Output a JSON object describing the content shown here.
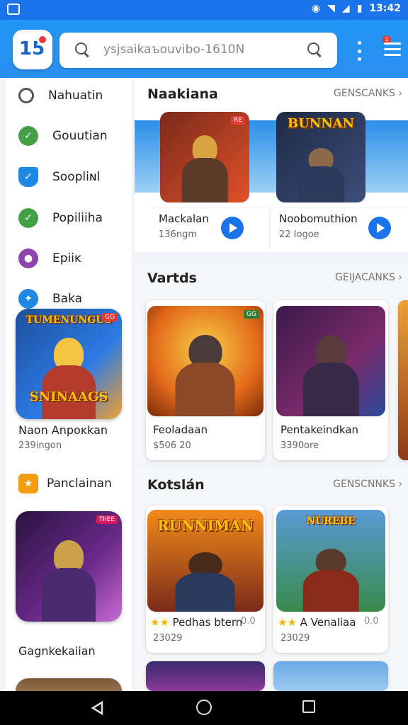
{
  "status": {
    "time": "13:42"
  },
  "header": {
    "logo_text": "15",
    "search_text": "ysjsaikaъouvibo-1610N",
    "menu_badge": "1"
  },
  "sidebar": {
    "items": [
      {
        "label": "Nahuatin",
        "icon": "search-person-icon",
        "color": "#555555"
      },
      {
        "label": "Gouutian",
        "icon": "leaf-check-icon",
        "color": "#43a047"
      },
      {
        "label": "Soopliɴl",
        "icon": "shield-icon",
        "color": "#1e88e5"
      },
      {
        "label": "Popiliiha",
        "icon": "leaf-check-icon",
        "color": "#43a047"
      },
      {
        "label": "Epiiĸ",
        "icon": "person-icon",
        "color": "#8e44ad"
      },
      {
        "label": "Baka",
        "icon": "runner-icon",
        "color": "#1e88e5"
      }
    ],
    "featured": {
      "art_title_top": "TUMENUNGUS",
      "art_title_bottom": "SNINAAGS",
      "tag": "GG",
      "title": "Naon Anpoĸkan",
      "sub": "239ingon"
    },
    "section2": {
      "icon": "trophy-icon",
      "label": "Panclainan"
    },
    "card2_tag": "TIIEE",
    "footer_label": "Gagnkekaiian"
  },
  "sections": [
    {
      "title": "Naakiana",
      "more": "GENSCANKS ›",
      "cards": [
        {
          "title": "Mackalan",
          "sub": "136ngm",
          "art_title": "",
          "tag": "RE"
        },
        {
          "title": "Noobomuthion",
          "sub": "22 Iogoe",
          "art_title": "BUNNAN",
          "tag": ""
        }
      ]
    },
    {
      "title": "Vartds",
      "more": "GEIJACANKS ›",
      "cards": [
        {
          "title": "Feoladaan",
          "sub": "$506 20",
          "tag": "GG"
        },
        {
          "title": "Pentakeindkan",
          "sub": "3390ore",
          "tag": ""
        }
      ]
    },
    {
      "title": "Kotslán",
      "more": "GENSCNNKS ›",
      "cards": [
        {
          "title": "Pedhas btern",
          "sub": "23029",
          "rating": "0.0",
          "art_title": "RUNNIMAN",
          "tag": ""
        },
        {
          "title": "A Venaliaa",
          "sub": "23029",
          "rating": "0.0",
          "art_title": "NUREBE",
          "tag": ""
        }
      ]
    }
  ]
}
